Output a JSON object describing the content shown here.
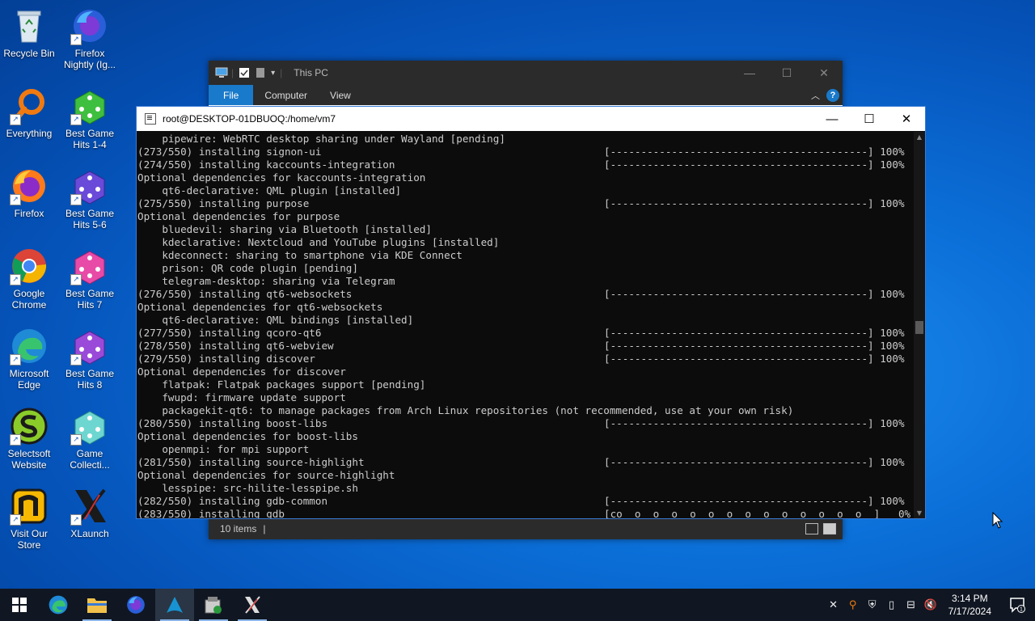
{
  "desktop": {
    "icons": [
      {
        "label": "Recycle Bin"
      },
      {
        "label": "Firefox Nightly (Ig..."
      },
      {
        "label": "Everything"
      },
      {
        "label": "Best Game Hits 1-4"
      },
      {
        "label": "Firefox"
      },
      {
        "label": "Best Game Hits 5-6"
      },
      {
        "label": "Google Chrome"
      },
      {
        "label": "Best Game Hits 7"
      },
      {
        "label": "Microsoft Edge"
      },
      {
        "label": "Best Game Hits 8"
      },
      {
        "label": "Selectsoft Website"
      },
      {
        "label": "Game Collecti..."
      },
      {
        "label": "Visit Our Store"
      },
      {
        "label": "XLaunch"
      }
    ]
  },
  "explorer": {
    "title": "This PC",
    "tabs": [
      "File",
      "Computer",
      "View"
    ],
    "status_count": "10 items",
    "status_sep": "|"
  },
  "terminal": {
    "title": "root@DESKTOP-01DBUOQ:/home/vm7",
    "lines": [
      {
        "text": "    pipewire: WebRTC desktop sharing under Wayland [pending]",
        "right": ""
      },
      {
        "text": "(273/550) installing signon-ui",
        "right": "[------------------------------------------] 100%"
      },
      {
        "text": "(274/550) installing kaccounts-integration",
        "right": "[------------------------------------------] 100%"
      },
      {
        "text": "Optional dependencies for kaccounts-integration",
        "right": ""
      },
      {
        "text": "    qt6-declarative: QML plugin [installed]",
        "right": ""
      },
      {
        "text": "(275/550) installing purpose",
        "right": "[------------------------------------------] 100%"
      },
      {
        "text": "Optional dependencies for purpose",
        "right": ""
      },
      {
        "text": "    bluedevil: sharing via Bluetooth [installed]",
        "right": ""
      },
      {
        "text": "    kdeclarative: Nextcloud and YouTube plugins [installed]",
        "right": ""
      },
      {
        "text": "    kdeconnect: sharing to smartphone via KDE Connect",
        "right": ""
      },
      {
        "text": "    prison: QR code plugin [pending]",
        "right": ""
      },
      {
        "text": "    telegram-desktop: sharing via Telegram",
        "right": ""
      },
      {
        "text": "(276/550) installing qt6-websockets",
        "right": "[------------------------------------------] 100%"
      },
      {
        "text": "Optional dependencies for qt6-websockets",
        "right": ""
      },
      {
        "text": "    qt6-declarative: QML bindings [installed]",
        "right": ""
      },
      {
        "text": "(277/550) installing qcoro-qt6",
        "right": "[------------------------------------------] 100%"
      },
      {
        "text": "(278/550) installing qt6-webview",
        "right": "[------------------------------------------] 100%"
      },
      {
        "text": "(279/550) installing discover",
        "right": "[------------------------------------------] 100%"
      },
      {
        "text": "Optional dependencies for discover",
        "right": ""
      },
      {
        "text": "    flatpak: Flatpak packages support [pending]",
        "right": ""
      },
      {
        "text": "    fwupd: firmware update support",
        "right": ""
      },
      {
        "text": "    packagekit-qt6: to manage packages from Arch Linux repositories (not recommended, use at your own risk)",
        "right": ""
      },
      {
        "text": "(280/550) installing boost-libs",
        "right": "[------------------------------------------] 100%"
      },
      {
        "text": "Optional dependencies for boost-libs",
        "right": ""
      },
      {
        "text": "    openmpi: for mpi support",
        "right": ""
      },
      {
        "text": "(281/550) installing source-highlight",
        "right": "[------------------------------------------] 100%"
      },
      {
        "text": "Optional dependencies for source-highlight",
        "right": ""
      },
      {
        "text": "    lesspipe: src-hilite-lesspipe.sh",
        "right": ""
      },
      {
        "text": "(282/550) installing gdb-common",
        "right": "[------------------------------------------] 100%"
      },
      {
        "text": "(283/550) installing gdb",
        "right": "[co  o  o  o  o  o  o  o  o  o  o  o  o  o  ]   0%"
      }
    ]
  },
  "taskbar": {
    "time": "3:14 PM",
    "date": "7/17/2024",
    "notification_count": "1"
  },
  "colors": {
    "accent": "#1979ca",
    "taskbar": "#101722",
    "terminal_bg": "#0c0c0c",
    "terminal_fg": "#cccccc"
  }
}
